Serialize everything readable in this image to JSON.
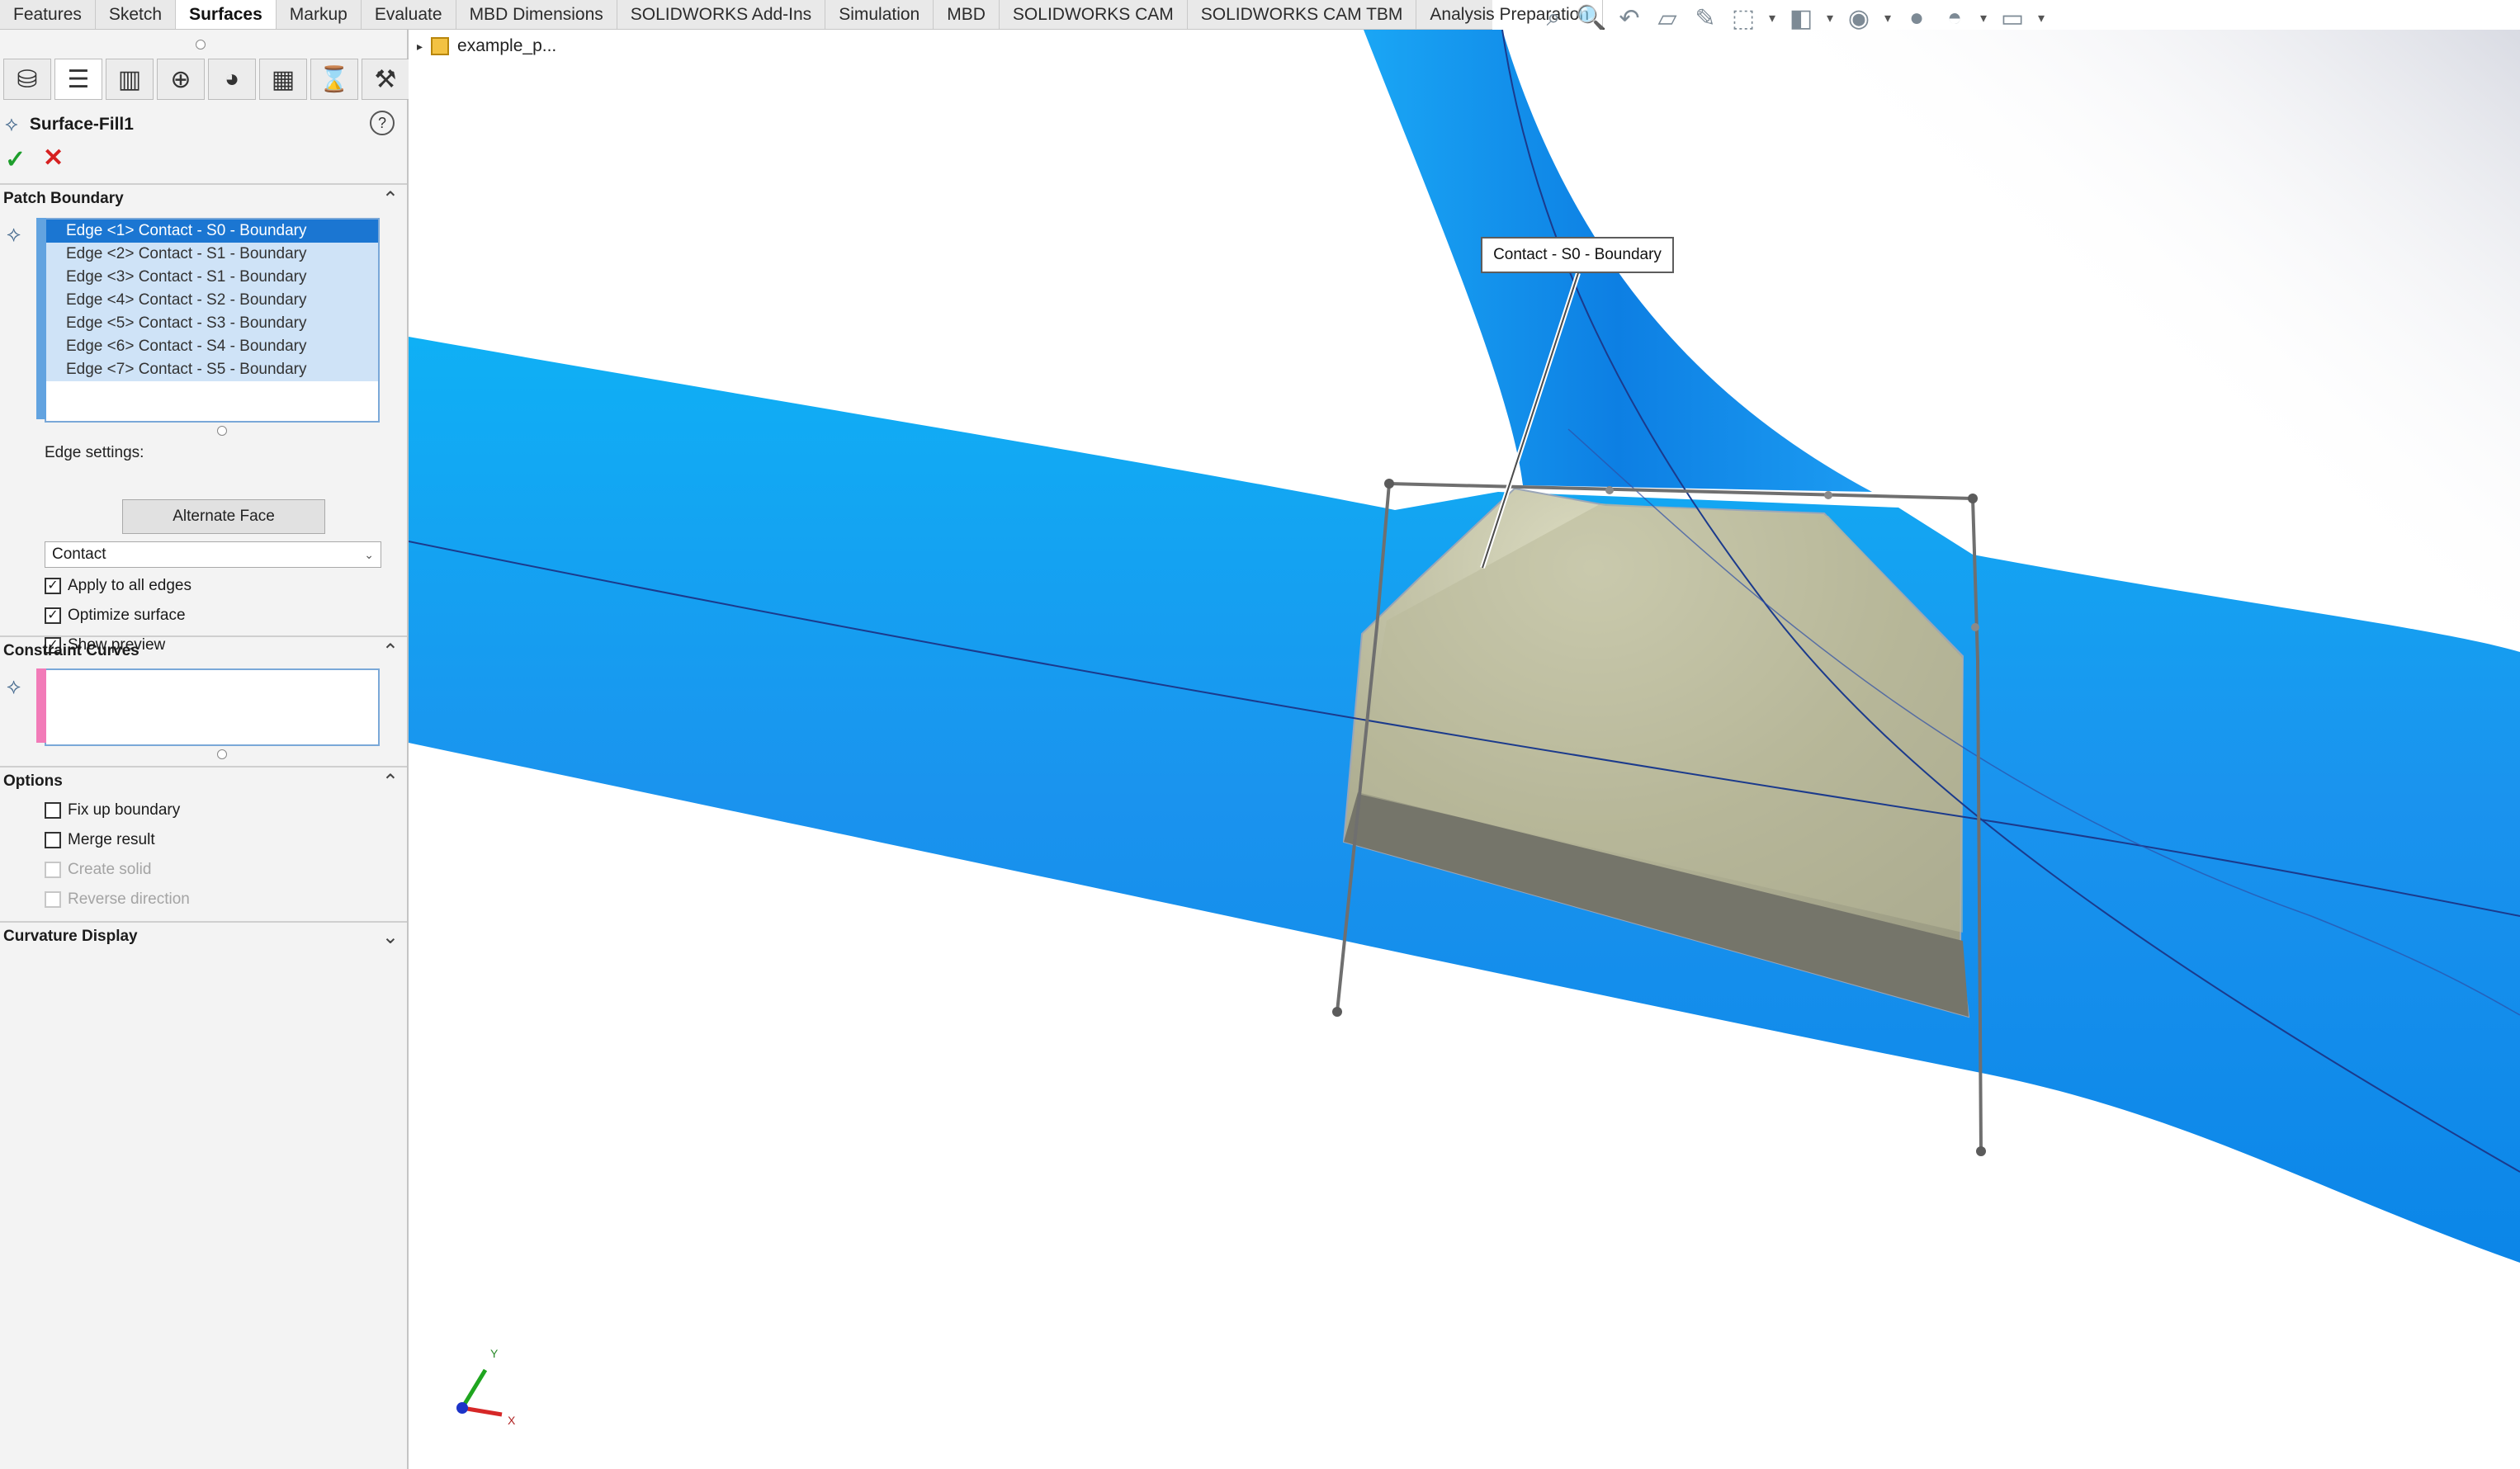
{
  "ribbon": {
    "tabs": [
      "Features",
      "Sketch",
      "Surfaces",
      "Markup",
      "Evaluate",
      "MBD Dimensions",
      "SOLIDWORKS Add-Ins",
      "Simulation",
      "MBD",
      "SOLIDWORKS CAM",
      "SOLIDWORKS CAM TBM",
      "Analysis Preparation"
    ],
    "active": "Surfaces"
  },
  "feature_tree": {
    "root_label": "example_p..."
  },
  "property_manager": {
    "title": "Surface-Fill1",
    "help_symbol": "?",
    "ok_symbol": "✓",
    "cancel_symbol": "✕",
    "patch_boundary": {
      "heading": "Patch Boundary",
      "edges": [
        "Edge <1> Contact - S0 - Boundary",
        "Edge <2> Contact - S1 - Boundary",
        "Edge <3> Contact - S1 - Boundary",
        "Edge <4> Contact - S2 - Boundary",
        "Edge <5> Contact - S3 - Boundary",
        "Edge <6> Contact - S4 - Boundary",
        "Edge <7> Contact - S5 - Boundary"
      ],
      "edge_settings_label": "Edge settings:",
      "alternate_face_label": "Alternate Face",
      "condition_value": "Contact",
      "apply_all_label": "Apply to all edges",
      "optimize_label": "Optimize surface",
      "show_preview_label": "Show preview"
    },
    "constraint_curves": {
      "heading": "Constraint Curves"
    },
    "options": {
      "heading": "Options",
      "fix_up_label": "Fix up boundary",
      "merge_label": "Merge result",
      "create_solid_label": "Create solid",
      "reverse_label": "Reverse direction"
    },
    "curvature_display": {
      "heading": "Curvature Display"
    }
  },
  "graphics": {
    "callout_text": "Contact - S0 - Boundary",
    "axis_x": "X",
    "axis_y": "Y",
    "colors": {
      "surface_blue": "#1a9cf0",
      "patch_fill": "#b9b99a",
      "selection": "#1b76d2"
    }
  }
}
